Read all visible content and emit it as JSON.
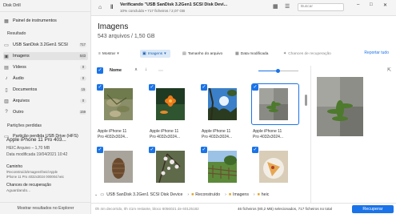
{
  "app": {
    "title": "Disk Drill"
  },
  "sidebar": {
    "dashboard": "Painel de instrumentos",
    "result_heading": "Resultado",
    "items": [
      {
        "label": "USB  SanDisk 3.2Gen1 SCSI",
        "count": "717",
        "icon": "drive-icon"
      },
      {
        "label": "Imagens",
        "count": "543",
        "icon": "image-icon"
      },
      {
        "label": "Vídeos",
        "count": "0",
        "icon": "video-icon"
      },
      {
        "label": "Áudio",
        "count": "0",
        "icon": "audio-icon"
      },
      {
        "label": "Documentos",
        "count": "15",
        "icon": "document-icon"
      },
      {
        "label": "Arquivos",
        "count": "0",
        "icon": "archive-icon"
      },
      {
        "label": "Outro",
        "count": "159",
        "icon": "other-icon"
      }
    ],
    "lost_heading": "Partições perdidas",
    "lost_item": "Partição perdida USB Drive (HFS)",
    "bottom_link": "Mostrar resultados no Explorer"
  },
  "topbar": {
    "title": "Verificando \"USB  SanDisk 3.2Gen1 SCSI Disk Devi...",
    "subtitle": "10% concluído • 717 ficheiros / 2,07 GB",
    "search_placeholder": "Buscar"
  },
  "header": {
    "title": "Imagens",
    "subtitle": "543 arquivos / 1,50 GB"
  },
  "filters": {
    "show": "Mostrar",
    "images": "Imagens",
    "file_size": "Tamanho do arquivo",
    "date": "Data modificada",
    "chances": "Chances de recuperação",
    "report": "Reportar tudo"
  },
  "columns": {
    "name": "Nome"
  },
  "grid": [
    {
      "caption1": "Apple iPhone 11",
      "caption2": "Pro 4032x3024...",
      "selected": false,
      "thumb": "leaves"
    },
    {
      "caption1": "Apple iPhone 11",
      "caption2": "Pro 4032x3024...",
      "selected": false,
      "thumb": "orange-flower"
    },
    {
      "caption1": "Apple iPhone 11",
      "caption2": "Pro 4032x3024...",
      "selected": false,
      "thumb": "sky-tree"
    },
    {
      "caption1": "Apple iPhone 11",
      "caption2": "Pro 4032x3024...",
      "selected": true,
      "thumb": "rocks-plant"
    },
    {
      "caption1": "",
      "caption2": "",
      "selected": false,
      "thumb": "pinecone"
    },
    {
      "caption1": "",
      "caption2": "",
      "selected": false,
      "thumb": "blossom"
    },
    {
      "caption1": "",
      "caption2": "",
      "selected": false,
      "thumb": "fence-field"
    },
    {
      "caption1": "",
      "caption2": "",
      "selected": false,
      "thumb": "pizza-plate"
    }
  ],
  "preview": {
    "title": "Apple iPhone 11 Pro 403...",
    "meta1": "HEIC Arquivo – 1,70 MB",
    "meta2": "Data modificada 19/04/2021 10:42",
    "path_label": "Caminho",
    "path_value1": "\\Reconstruído\\Imagens\\heic\\Apple",
    "path_value2": "iPhone 11 Pro 4032x3024 000004.heic",
    "chances_label": "Chances de recuperação",
    "chances_value": "Aguardando..."
  },
  "pathbar": [
    "USB  SanDisk 3.2Gen1 SCSI Disk Device",
    "Reconstruído",
    "Imagens",
    "heic"
  ],
  "status": {
    "left": "0h 4m decorrido, 0h 41m restante, bloco 6056021 de 60125182",
    "right": "46 ficheiros (80,2 MB) selecionados, 717 ficheiros no total",
    "recover": "Recuperar"
  }
}
